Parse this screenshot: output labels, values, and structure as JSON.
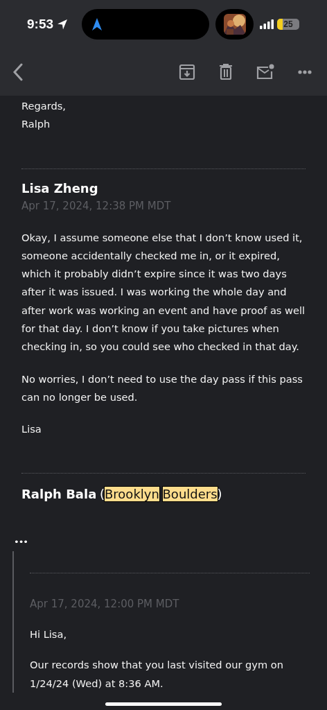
{
  "status_bar": {
    "time": "9:53",
    "battery": "25"
  },
  "previous_message_tail": [
    "Regards,",
    "Ralph"
  ],
  "message": {
    "sender": "Lisa Zheng",
    "date": "Apr 17, 2024, 12:38 PM MDT",
    "paragraphs": [
      "Okay, I assume someone else that I don’t know used it, someone accidentally checked me in, or it expired, which it probably didn’t expire since it was two days after it was issued. I was working the whole day and after work was working an event and have proof as well for that day. I don’t know if you take pictures when checking in, so you could see who checked in that day.",
      "No worries, I don’t need to use the day pass if this pass can no longer be used.",
      "Lisa"
    ]
  },
  "reply": {
    "sender": "Ralph Bala",
    "affiliation": {
      "prefix": "(",
      "words": [
        "Brooklyn",
        "Boulders"
      ],
      "suffix": ")",
      "highlighted": true
    },
    "toggle": "•••",
    "quote": {
      "date": "Apr 17, 2024, 12:00 PM MDT",
      "paragraphs": [
        "Hi Lisa,",
        "Our records show that you last visited our gym on 1/24/24 (Wed) at 8:36 AM."
      ]
    }
  }
}
